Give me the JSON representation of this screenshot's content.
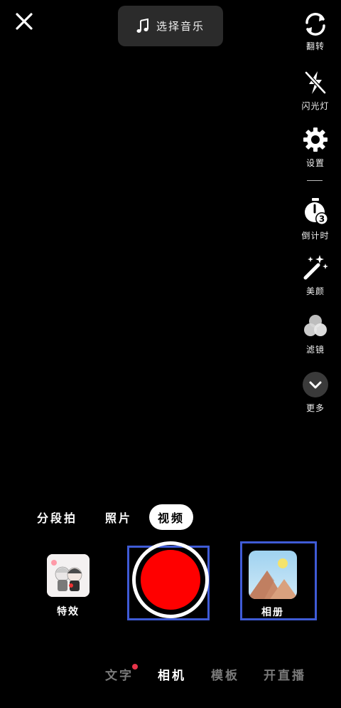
{
  "top": {
    "close_icon": "close-icon",
    "music": {
      "icon": "music-note-icon",
      "label": "选择音乐"
    }
  },
  "tools": [
    {
      "key": "flip",
      "icon": "flip-camera-icon",
      "label": "翻转"
    },
    {
      "key": "flash",
      "icon": "flash-off-icon",
      "label": "闪光灯"
    },
    {
      "key": "settings",
      "icon": "gear-icon",
      "label": "设置"
    },
    {
      "key": "timer",
      "icon": "timer-icon",
      "label": "倒计时",
      "badge": "3"
    },
    {
      "key": "beauty",
      "icon": "magic-wand-icon",
      "label": "美颜"
    },
    {
      "key": "filter",
      "icon": "filter-circles-icon",
      "label": "滤镜"
    },
    {
      "key": "more",
      "icon": "chevron-down-icon",
      "label": "更多"
    }
  ],
  "modes": {
    "segment": "分段拍",
    "photo": "照片",
    "video": "视频",
    "active": "video"
  },
  "effects": {
    "label": "特效"
  },
  "album": {
    "label": "相册"
  },
  "bottom_tabs": {
    "text": "文字",
    "camera": "相机",
    "template": "模板",
    "live": "开直播",
    "active": "camera"
  },
  "colors": {
    "background": "#000000",
    "record": "#ff0000",
    "highlight_box": "#3f5bd6",
    "notify_dot": "#e8344a"
  }
}
